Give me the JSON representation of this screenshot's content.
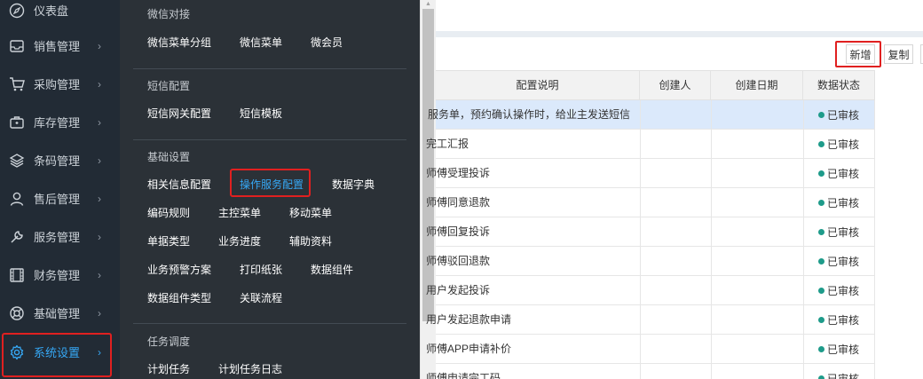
{
  "sidebar": {
    "items": [
      {
        "label": "仪表盘",
        "icon": "dashboard-icon"
      },
      {
        "label": "销售管理",
        "icon": "inbox-icon"
      },
      {
        "label": "采购管理",
        "icon": "cart-icon"
      },
      {
        "label": "库存管理",
        "icon": "briefcase-icon"
      },
      {
        "label": "条码管理",
        "icon": "layers-icon"
      },
      {
        "label": "售后管理",
        "icon": "user-icon"
      },
      {
        "label": "服务管理",
        "icon": "wrench-icon"
      },
      {
        "label": "财务管理",
        "icon": "film-icon"
      },
      {
        "label": "基础管理",
        "icon": "life-ring-icon"
      },
      {
        "label": "系统设置",
        "icon": "gear-icon"
      }
    ],
    "arrow": "›"
  },
  "flyout": {
    "groups": [
      {
        "title": "微信对接",
        "links": [
          "微信菜单分组",
          "微信菜单",
          "微会员"
        ]
      },
      {
        "title": "短信配置",
        "links": [
          "短信网关配置",
          "短信模板"
        ]
      },
      {
        "title": "基础设置",
        "links": [
          "相关信息配置",
          "操作服务配置",
          "数据字典",
          "编码规则",
          "主控菜单",
          "移动菜单",
          "单据类型",
          "业务进度",
          "辅助资料",
          "业务预警方案",
          "打印纸张",
          "数据组件",
          "数据组件类型",
          "关联流程"
        ]
      },
      {
        "title": "任务调度",
        "links": [
          "计划任务",
          "计划任务日志"
        ]
      }
    ]
  },
  "toolbar": {
    "add_label": "新增",
    "copy_label": "复制"
  },
  "table": {
    "columns": [
      "配置说明",
      "创建人",
      "创建日期",
      "数据状态"
    ],
    "rows": [
      {
        "desc": "服务单，预约确认操作时，给业主发送短信",
        "status": "已审核"
      },
      {
        "desc": "完工汇报",
        "status": "已审核"
      },
      {
        "desc": "师傅受理投诉",
        "status": "已审核"
      },
      {
        "desc": "师傅同意退款",
        "status": "已审核"
      },
      {
        "desc": "师傅回复投诉",
        "status": "已审核"
      },
      {
        "desc": "师傅驳回退款",
        "status": "已审核"
      },
      {
        "desc": "用户发起投诉",
        "status": "已审核"
      },
      {
        "desc": "用户发起退款申请",
        "status": "已审核"
      },
      {
        "desc": "师傅APP申请补价",
        "status": "已审核"
      },
      {
        "desc": "师傅申请完工码",
        "status": "已审核"
      }
    ]
  },
  "colors": {
    "accent": "#36a8f5",
    "highlight": "#e02020",
    "status_dot": "#1e9b8a"
  }
}
